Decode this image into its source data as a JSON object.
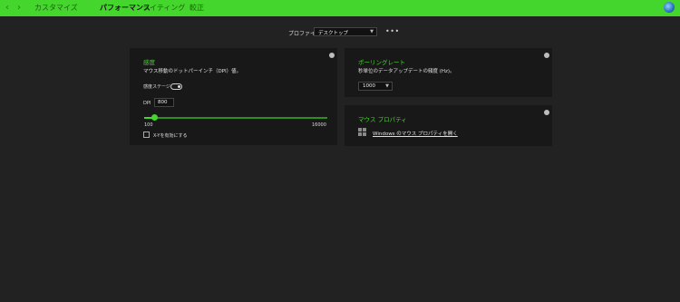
{
  "nav": {
    "back": "‹",
    "forward": "›",
    "tabs": [
      {
        "label": "カスタマイズ"
      },
      {
        "label": "パフォーマンス"
      },
      {
        "label": "ライティング"
      },
      {
        "label": "較正"
      }
    ],
    "active_tab": "パフォーマンス"
  },
  "profile": {
    "label": "プロファイル",
    "value": "デスクトップ",
    "more": "•••"
  },
  "sensitivity": {
    "title": "感度",
    "description": "マウス移動のドットパーインチ（DPI）値。",
    "stages_label": "感度ステージ",
    "stages_enabled": false,
    "dpi_label": "DPI",
    "dpi_value": "800",
    "slider_min": "100",
    "slider_max": "16000",
    "slider_fraction": 0.044,
    "xy_label": "X-Yを有効にする",
    "xy_checked": false
  },
  "polling": {
    "title": "ポーリングレート",
    "description": "秒単位のデータアップデートの頻度 (Hz)。",
    "value": "1000"
  },
  "mouse_props": {
    "title": "マウス プロパティ",
    "link": "Windows のマウス プロパティを開く"
  },
  "colors": {
    "accent": "#44d62c",
    "background": "#222222",
    "panel": "#181818"
  }
}
